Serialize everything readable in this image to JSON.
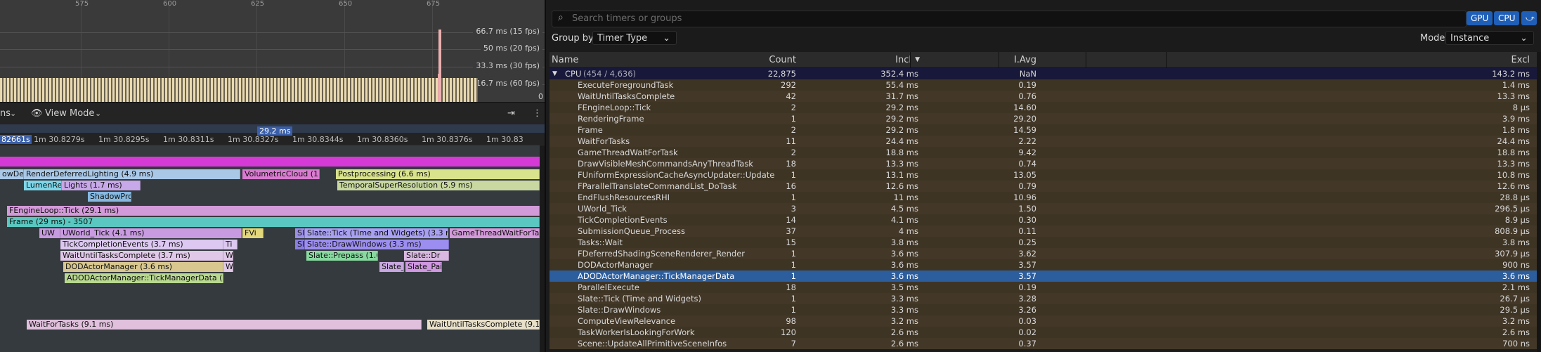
{
  "graph": {
    "ticks": [
      "575",
      "600",
      "625",
      "650",
      "675"
    ],
    "fps_labels": [
      "66.7 ms (15 fps)",
      "50 ms (20 fps)",
      "33.3 ms (30 fps)",
      "16.7 ms (60 fps)"
    ],
    "zero_label": "0"
  },
  "timeline_toolbar": {
    "prefix": "ns",
    "view_mode_label": "View Mode"
  },
  "ruler": {
    "selection_label": "29.2 ms",
    "labels": [
      "82661s",
      "1m 30.8279s",
      "1m 30.8295s",
      "1m 30.8311s",
      "1m 30.8327s",
      "1m 30.8344s",
      "1m 30.8360s",
      "1m 30.8376s",
      "1m 30.83"
    ]
  },
  "tracks": {
    "events": [
      "owDe",
      "RenderDeferredLighting (4.9 ms)",
      "VolumetricCloud (1.",
      "Postprocessing (6.6 ms)",
      "LumenRef",
      "Lights (1.7 ms)",
      "TemporalSuperResolution (5.9 ms)",
      "ShadowPro",
      "FEngineLoop::Tick (29.1 ms)",
      "Frame (29 ms) - 3507",
      "UW",
      "UWorld_Tick (4.1 ms)",
      "FVi",
      "Sl",
      "Slate::Tick (Time and Widgets) (3.3 ms)",
      "GameThreadWaitForTask",
      "TickCompletionEvents (3.7 ms)",
      "Ti",
      "Sl",
      "Slate::DrawWindows (3.3 ms)",
      "WaitUntilTasksComplete (3.7 ms)",
      "W",
      "Slate::Prepass (1.6",
      "Slate::Dr",
      "DODActorManager (3.6 ms)",
      "W",
      "Slate_",
      "Slate_Pai",
      "ADODActorManager::TickManagerData (3.6",
      "WaitForTasks (9.1 ms)",
      "WaitUntilTasksComplete (9.1 m"
    ]
  },
  "search": {
    "placeholder": "Search timers or groups"
  },
  "buttons": {
    "gpu": "GPU",
    "cpu": "CPU"
  },
  "group_by": {
    "label": "Group by",
    "value": "Timer Type"
  },
  "mode": {
    "label": "Mode",
    "value": "Instance"
  },
  "columns": [
    "Name",
    "Count",
    "Incl",
    "I.Avg",
    "Excl"
  ],
  "rows": [
    {
      "name": "CPU",
      "sub": "(454 / 4,636)",
      "count": "22,875",
      "incl": "352.4 ms",
      "avg": "NaN",
      "excl": "143.2 ms"
    },
    {
      "name": "ExecuteForegroundTask",
      "count": "292",
      "incl": "55.4 ms",
      "avg": "0.19",
      "excl": "1.4 ms"
    },
    {
      "name": "WaitUntilTasksComplete",
      "count": "42",
      "incl": "31.7 ms",
      "avg": "0.76",
      "excl": "13.3 ms"
    },
    {
      "name": "FEngineLoop::Tick",
      "count": "2",
      "incl": "29.2 ms",
      "avg": "14.60",
      "excl": "8 μs"
    },
    {
      "name": "RenderingFrame",
      "count": "1",
      "incl": "29.2 ms",
      "avg": "29.20",
      "excl": "3.9 ms"
    },
    {
      "name": "Frame",
      "count": "2",
      "incl": "29.2 ms",
      "avg": "14.59",
      "excl": "1.8 ms"
    },
    {
      "name": "WaitForTasks",
      "count": "11",
      "incl": "24.4 ms",
      "avg": "2.22",
      "excl": "24.4 ms"
    },
    {
      "name": "GameThreadWaitForTask",
      "count": "2",
      "incl": "18.8 ms",
      "avg": "9.42",
      "excl": "18.8 ms"
    },
    {
      "name": "DrawVisibleMeshCommandsAnyThreadTask",
      "count": "18",
      "incl": "13.3 ms",
      "avg": "0.74",
      "excl": "13.3 ms"
    },
    {
      "name": "FUniformExpressionCacheAsyncUpdater::Update",
      "count": "1",
      "incl": "13.1 ms",
      "avg": "13.05",
      "excl": "10.8 ms"
    },
    {
      "name": "FParallelTranslateCommandList_DoTask",
      "count": "16",
      "incl": "12.6 ms",
      "avg": "0.79",
      "excl": "12.6 ms"
    },
    {
      "name": "EndFlushResourcesRHI",
      "count": "1",
      "incl": "11 ms",
      "avg": "10.96",
      "excl": "28.8 μs"
    },
    {
      "name": "UWorld_Tick",
      "count": "3",
      "incl": "4.5 ms",
      "avg": "1.50",
      "excl": "296.5 μs"
    },
    {
      "name": "TickCompletionEvents",
      "count": "14",
      "incl": "4.1 ms",
      "avg": "0.30",
      "excl": "8.9 μs"
    },
    {
      "name": "SubmissionQueue_Process",
      "count": "37",
      "incl": "4 ms",
      "avg": "0.11",
      "excl": "808.9 μs"
    },
    {
      "name": "Tasks::Wait",
      "count": "15",
      "incl": "3.8 ms",
      "avg": "0.25",
      "excl": "3.8 ms"
    },
    {
      "name": "FDeferredShadingSceneRenderer_Render",
      "count": "1",
      "incl": "3.6 ms",
      "avg": "3.62",
      "excl": "307.9 μs"
    },
    {
      "name": "DODActorManager",
      "count": "1",
      "incl": "3.6 ms",
      "avg": "3.57",
      "excl": "900 ns"
    },
    {
      "name": "ADODActorManager::TickManagerData",
      "count": "1",
      "incl": "3.6 ms",
      "avg": "3.57",
      "excl": "3.6 ms"
    },
    {
      "name": "ParallelExecute",
      "count": "18",
      "incl": "3.5 ms",
      "avg": "0.19",
      "excl": "2.1 ms"
    },
    {
      "name": "Slate::Tick (Time and Widgets)",
      "count": "1",
      "incl": "3.3 ms",
      "avg": "3.28",
      "excl": "26.7 μs"
    },
    {
      "name": "Slate::DrawWindows",
      "count": "1",
      "incl": "3.3 ms",
      "avg": "3.26",
      "excl": "29.5 μs"
    },
    {
      "name": "ComputeViewRelevance",
      "count": "98",
      "incl": "3.2 ms",
      "avg": "0.03",
      "excl": "3.2 ms"
    },
    {
      "name": "TaskWorkerIsLookingForWork",
      "count": "120",
      "incl": "2.6 ms",
      "avg": "0.02",
      "excl": "2.6 ms"
    },
    {
      "name": "Scene::UpdateAllPrimitiveSceneInfos",
      "count": "7",
      "incl": "2.6 ms",
      "avg": "0.37",
      "excl": "700 ns"
    }
  ]
}
